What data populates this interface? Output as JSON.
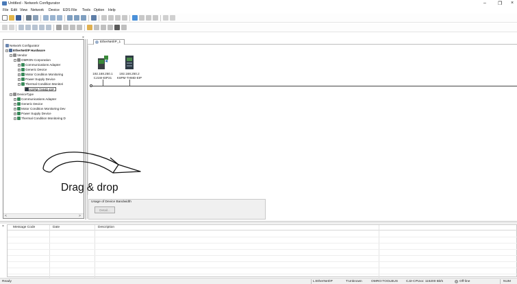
{
  "window": {
    "title": "Untitled - Network Configurator",
    "minimize_glyph": "–",
    "maximize_glyph": "❐",
    "close_glyph": "×"
  },
  "menu": [
    "File",
    "Edit",
    "View",
    "Network",
    "Device",
    "EDS File",
    "Tools",
    "Option",
    "Help"
  ],
  "hardware_tree": {
    "close_glyph": "×",
    "root": "Network Configurator",
    "hardware": "EtherNet/IP Hardware",
    "vendor": "Vendor",
    "omron": "OMRON Corporation",
    "vendor_items": [
      "Communications Adapter",
      "Generic Device",
      "Motor Condition Monitoring",
      "Power Supply Device",
      "Thermal Condition Monitori"
    ],
    "selected_device": "K6PM-THMD-EIP",
    "devicetype": "DeviceType",
    "type_items": [
      "Communications Adapter",
      "Generic Device",
      "Motor Condition Monitoring Dev",
      "Power Supply Device",
      "Thermal Condition Monitoring D"
    ],
    "scroll_left": "<",
    "scroll_right": ">"
  },
  "network": {
    "tab_label": "EtherNet/IP_1",
    "devices": [
      {
        "ip": "192.168.250.1",
        "model": "CJ1W-EIP21"
      },
      {
        "ip": "192.168.250.2",
        "model": "K6PM-THMD-EIP"
      }
    ]
  },
  "annotation": {
    "drag_label": "Drag & drop"
  },
  "bandwidth": {
    "legend": "Usage of Device Bandwidth",
    "detail_button": "Detail..."
  },
  "message_panel": {
    "close_glyph": "×",
    "columns": [
      "Message Code",
      "Date",
      "Description"
    ]
  },
  "status": {
    "ready": "Ready",
    "network": "L:EtherNet/IP",
    "target": "T:Unknown",
    "toolbus": "OMRO:TOOLBUS",
    "cpu": "CJ2-CPUxx: 115200 Bit/s",
    "online": "Off-line",
    "num": "NUM"
  },
  "colors": {
    "device_green": "#3a8a3a",
    "device_dark": "#2e3a44",
    "arrow_stroke": "#111111"
  }
}
